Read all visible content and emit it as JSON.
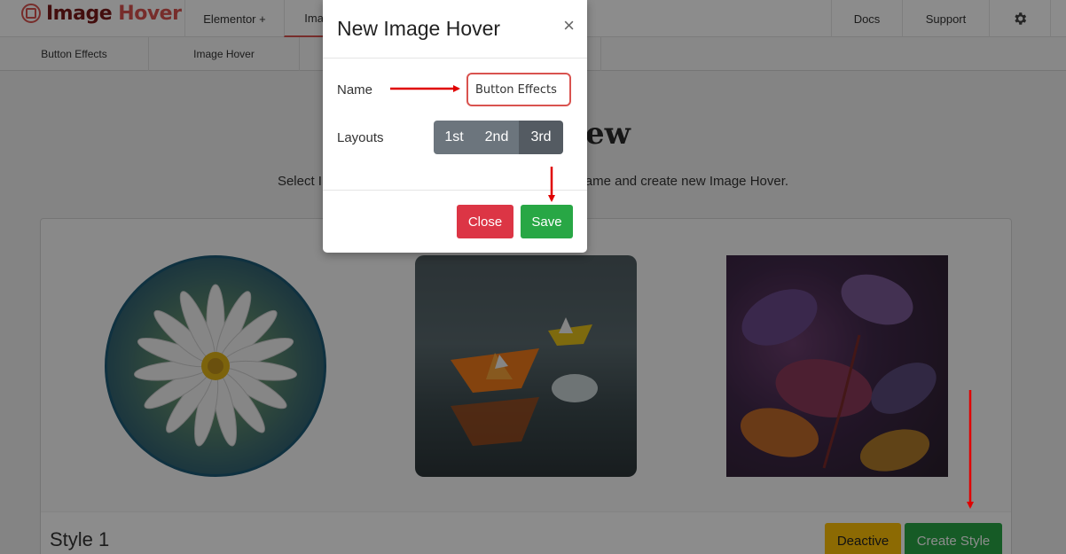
{
  "brand": {
    "name_part1": "Image ",
    "name_part2": "Hover"
  },
  "topnav": {
    "elementor": "Elementor +",
    "image": "Image Hover",
    "docs": "Docs",
    "support": "Support",
    "settings_icon": "gear-icon"
  },
  "subnav": {
    "tabs": [
      "Button Effects",
      "Image Hover"
    ]
  },
  "page": {
    "title": "Create New",
    "description": "Select Image Hover Style, Give your Image Hover Name and create new Image Hover."
  },
  "card": {
    "style_name": "Style 1",
    "deactive_label": "Deactive",
    "create_label": "Create Style"
  },
  "modal": {
    "title": "New Image Hover",
    "close_symbol": "×",
    "name_label": "Name",
    "name_value": "Button Effects",
    "layouts_label": "Layouts",
    "layouts": [
      "1st",
      "2nd",
      "3rd"
    ],
    "selected_layout": "3rd",
    "close_button": "Close",
    "save_button": "Save"
  },
  "colors": {
    "brand": "#d9534f",
    "success": "#28a745",
    "danger": "#dc3545",
    "warning": "#ffc107",
    "secondary": "#6c757d",
    "annotation": "#e00000"
  }
}
